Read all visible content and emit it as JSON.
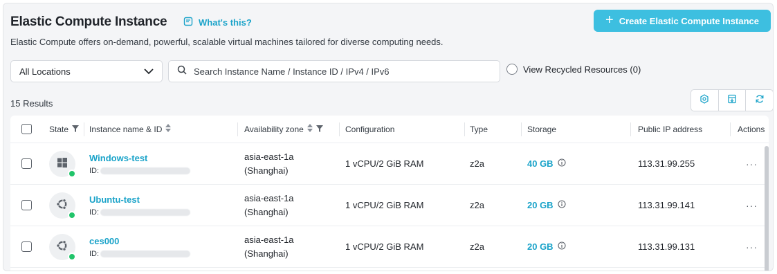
{
  "header": {
    "title": "Elastic Compute Instance",
    "whats_this": "What's this?",
    "description": "Elastic Compute offers on-demand, powerful, scalable virtual machines tailored for diverse computing needs.",
    "create_button": "Create Elastic Compute Instance"
  },
  "filters": {
    "location": "All Locations",
    "search_placeholder": "Search Instance Name / Instance ID / IPv4 / IPv6",
    "recycled_label": "View Recycled Resources (0)"
  },
  "results_count": "15 Results",
  "toolbar_icons": [
    "settings-icon",
    "export-icon",
    "refresh-icon"
  ],
  "table": {
    "columns": {
      "state": "State",
      "name": "Instance name & ID",
      "zone": "Availability zone",
      "config": "Configuration",
      "type": "Type",
      "storage": "Storage",
      "ip": "Public IP address",
      "actions": "Actions"
    },
    "rows": [
      {
        "os": "windows",
        "name": "Windows-test",
        "id_label": "ID:",
        "zone_line1": "asia-east-1a",
        "zone_line2": "(Shanghai)",
        "config": "1 vCPU/2 GiB RAM",
        "type": "z2a",
        "storage": "40 GB",
        "ip": "113.31.99.255",
        "actions": "···",
        "status": "running"
      },
      {
        "os": "ubuntu",
        "name": "Ubuntu-test",
        "id_label": "ID:",
        "zone_line1": "asia-east-1a",
        "zone_line2": "(Shanghai)",
        "config": "1 vCPU/2 GiB RAM",
        "type": "z2a",
        "storage": "20 GB",
        "ip": "113.31.99.141",
        "actions": "···",
        "status": "running"
      },
      {
        "os": "ubuntu",
        "name": "ces000",
        "id_label": "ID:",
        "zone_line1": "asia-east-1a",
        "zone_line2": "(Shanghai)",
        "config": "1 vCPU/2 GiB RAM",
        "type": "z2a",
        "storage": "20 GB",
        "ip": "113.31.99.131",
        "actions": "···",
        "status": "running"
      }
    ]
  },
  "colors": {
    "accent": "#3dbfe0",
    "link": "#1aa3c9",
    "status_running": "#21c46a"
  }
}
